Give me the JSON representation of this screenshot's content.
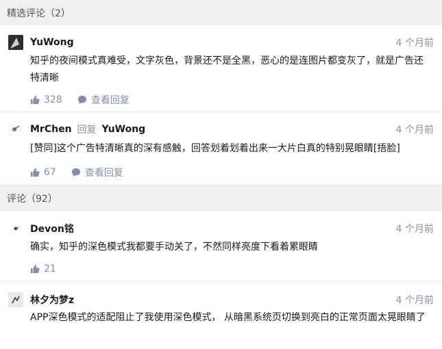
{
  "featured": {
    "header": "精选评论（2）",
    "comments": [
      {
        "author": "YuWong",
        "time": "4 个月前",
        "content": "知乎的夜间模式真难受，文字灰色，背景还不是全黑，恶心的是连图片都变灰了，就是广告还特清晰",
        "likes": "328",
        "view_replies": "查看回复"
      },
      {
        "author": "MrChen",
        "reply_word": "回复",
        "reply_to": "YuWong",
        "time": "4 个月前",
        "content": "[赞同]这个广告特清晰真的深有感触，回答划着划着出来一大片白真的特别晃眼睛[捂脸]",
        "likes": "67",
        "view_replies": "查看回复"
      }
    ]
  },
  "all": {
    "header": "评论（92）",
    "comments": [
      {
        "author": "Devon铭",
        "time": "4 个月前",
        "content": "确实，知乎的深色模式我都要手动关了，不然同样亮度下看着累眼睛",
        "likes": "21"
      },
      {
        "author": "林夕为梦z",
        "time": "4 个月前",
        "content": "APP深色模式的适配阻止了我使用深色模式， 从暗黑系统页切换到亮白的正常页面太晃眼睛了"
      }
    ]
  },
  "icons": {
    "like": "thumbs-up-icon",
    "reply": "chat-bubble-icon"
  },
  "colors": {
    "meta": "#8590a6",
    "section_bg": "#f0f0f1",
    "text": "#1a1a1a"
  }
}
